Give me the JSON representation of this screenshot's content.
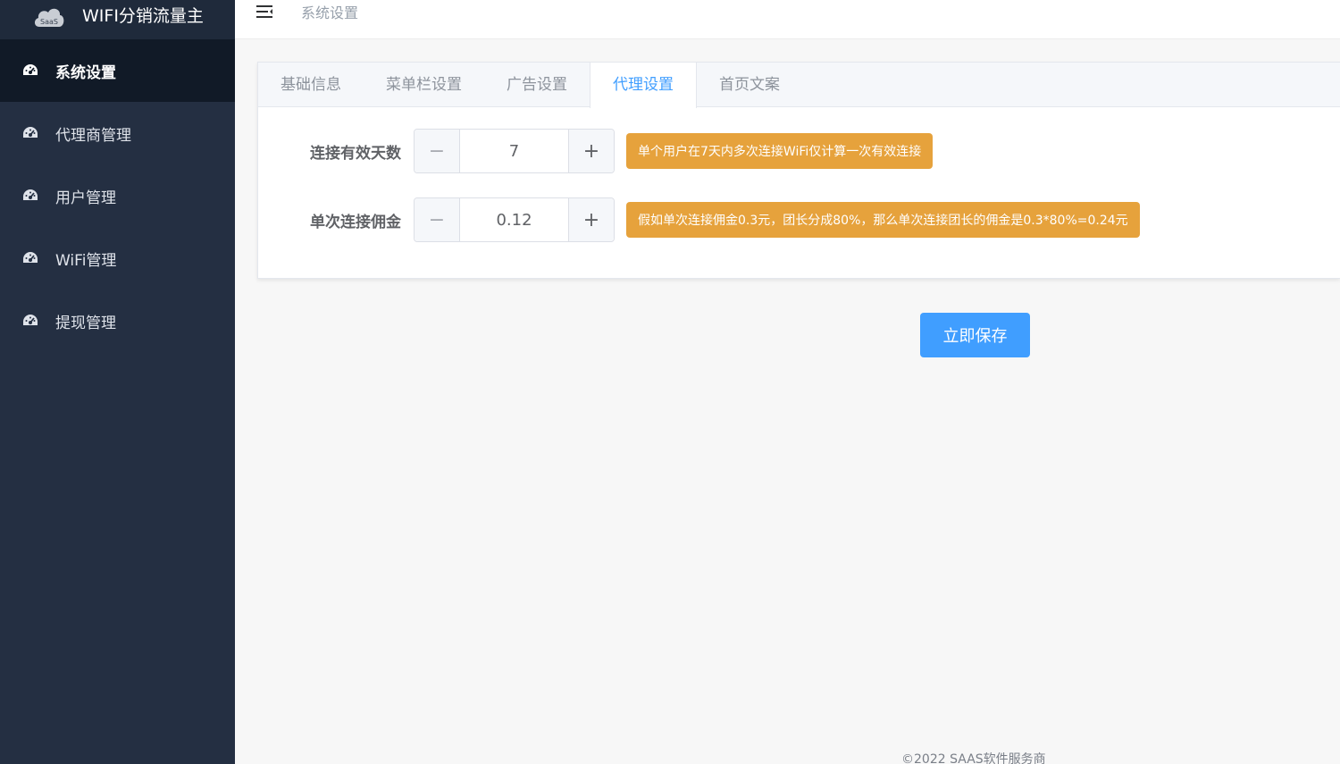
{
  "app": {
    "title": "WIFI分销流量主",
    "logo_text": "SaaS"
  },
  "sidebar": {
    "items": [
      {
        "label": "系统设置",
        "icon": "dashboard-icon",
        "active": true
      },
      {
        "label": "代理商管理",
        "icon": "dashboard-icon",
        "active": false
      },
      {
        "label": "用户管理",
        "icon": "dashboard-icon",
        "active": false
      },
      {
        "label": "WiFi管理",
        "icon": "dashboard-icon",
        "active": false
      },
      {
        "label": "提现管理",
        "icon": "dashboard-icon",
        "active": false
      }
    ]
  },
  "header": {
    "breadcrumb": "系统设置",
    "toggle_icon": "menu-fold-icon"
  },
  "tabs": [
    {
      "label": "基础信息",
      "active": false
    },
    {
      "label": "菜单栏设置",
      "active": false
    },
    {
      "label": "广告设置",
      "active": false
    },
    {
      "label": "代理设置",
      "active": true
    },
    {
      "label": "首页文案",
      "active": false
    }
  ],
  "form": {
    "valid_days": {
      "label": "连接有效天数",
      "value": "7",
      "tip": "单个用户在7天内多次连接WiFi仅计算一次有效连接"
    },
    "commission": {
      "label": "单次连接佣金",
      "value": "0.12",
      "tip": "假如单次连接佣金0.3元，团长分成80%，那么单次连接团长的佣金是0.3*80%=0.24元"
    },
    "minus_symbol": "−",
    "plus_symbol": "+"
  },
  "actions": {
    "save_label": "立即保存"
  },
  "footer": {
    "copyright": "©2022 SAAS软件服务商"
  },
  "colors": {
    "sidebar_bg": "#242f42",
    "sidebar_active": "#111a27",
    "primary": "#409eff",
    "warning": "#e6a23c"
  }
}
